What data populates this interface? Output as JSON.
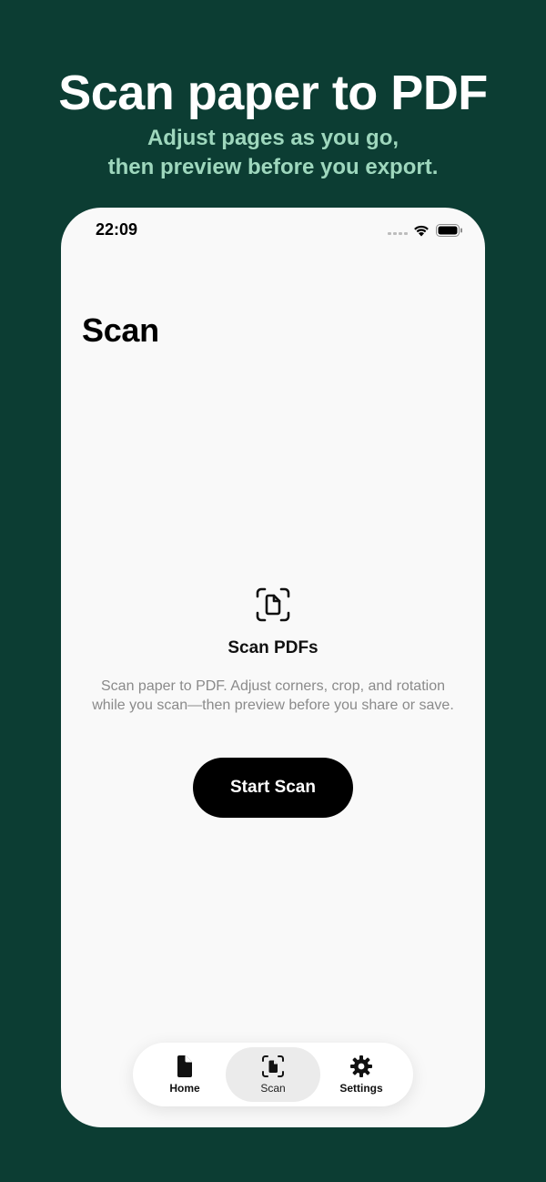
{
  "promo": {
    "title": "Scan paper to PDF",
    "subtitle_line1": "Adjust pages as you go,",
    "subtitle_line2": "then preview before you export."
  },
  "status_bar": {
    "time": "22:09",
    "icons": [
      "cellular-signal-icon",
      "wifi-icon",
      "battery-icon"
    ]
  },
  "page": {
    "title": "Scan"
  },
  "empty_state": {
    "icon": "document-scan-icon",
    "title": "Scan PDFs",
    "description": "Scan paper to PDF. Adjust corners, crop, and rotation while you scan—then preview before you share or save.",
    "button_label": "Start Scan"
  },
  "tab_bar": {
    "tabs": [
      {
        "label": "Home",
        "icon": "document-icon",
        "active": false
      },
      {
        "label": "Scan",
        "icon": "document-scan-icon",
        "active": true
      },
      {
        "label": "Settings",
        "icon": "gear-icon",
        "active": false
      }
    ]
  },
  "colors": {
    "background": "#0c3d33",
    "subtitle_accent": "#9ed7bd",
    "screen": "#f9f9f9",
    "button": "#000000"
  }
}
